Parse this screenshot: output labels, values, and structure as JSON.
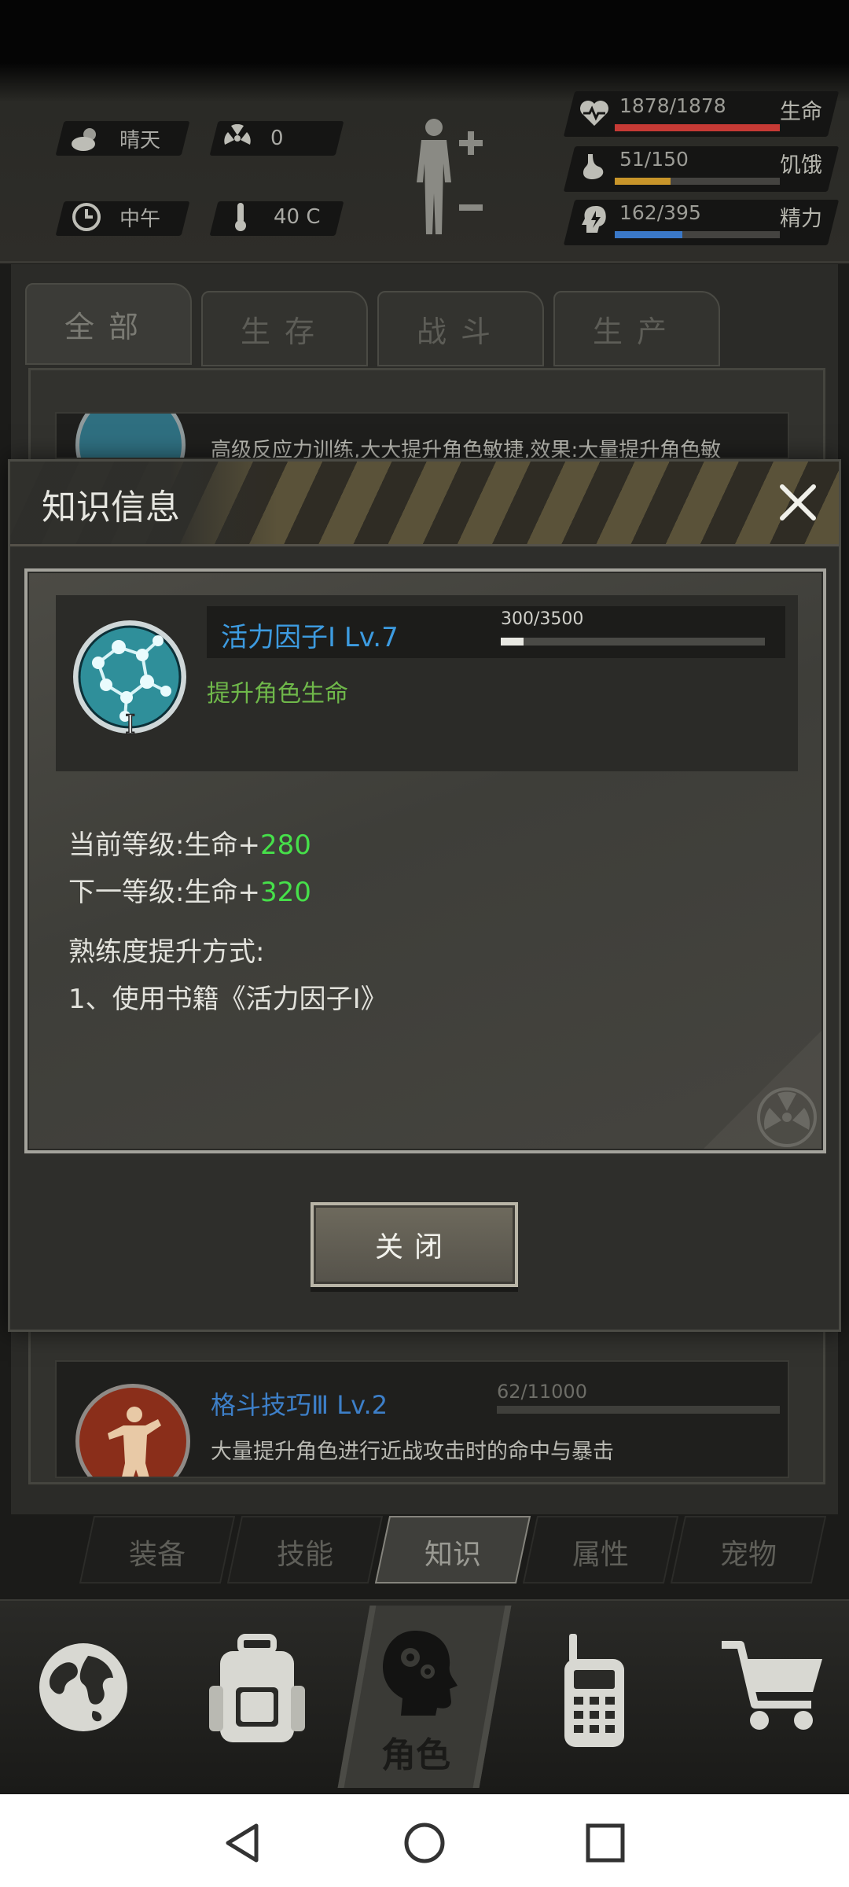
{
  "hud": {
    "weather": "晴天",
    "radiation": "0",
    "time": "中午",
    "temperature": "40 C",
    "health_value": "1878/1878",
    "health_label": "生命",
    "hunger_value": "51/150",
    "hunger_label": "饥饿",
    "energy_value": "162/395",
    "energy_label": "精力",
    "health_fill": 1.0,
    "hunger_fill": 0.34,
    "energy_fill": 0.41,
    "colors": {
      "health": "#c63a35",
      "hunger": "#c8952a",
      "energy": "#3a78c8"
    }
  },
  "knowledge_tabs": [
    "全部",
    "生存",
    "战斗",
    "生产"
  ],
  "list_top_card_desc": "高级反应力训练,大大提升角色敏捷,效果:大量提升角色敏",
  "modal": {
    "title": "知识信息",
    "skill_name": "活力因子Ⅰ",
    "skill_level": "Lv.7",
    "xp_text": "300/3500",
    "xp_progress": 0.0857,
    "skill_desc": "提升角色生命",
    "current_label": "当前等级:生命+",
    "current_value": "280",
    "next_label": "下一等级:生命+",
    "next_value": "320",
    "method_title": "熟练度提升方式:",
    "method_1": "1、使用书籍《活力因子Ⅰ》",
    "close_button": "关闭"
  },
  "list_bottom_card": {
    "name": "格斗技巧Ⅲ Lv.2",
    "xp": "62/11000",
    "desc": "大量提升角色进行近战攻击时的命中与暴击"
  },
  "sub_tabs": [
    "装备",
    "技能",
    "知识",
    "属性",
    "宠物"
  ],
  "sub_tab_active": "知识",
  "bottom_nav": {
    "role_label": "角色",
    "icons": [
      "globe-icon",
      "backpack-icon",
      "head-gears-icon",
      "walkie-talkie-icon",
      "cart-icon"
    ]
  },
  "system_nav": [
    "back-icon",
    "home-icon",
    "recents-icon"
  ]
}
